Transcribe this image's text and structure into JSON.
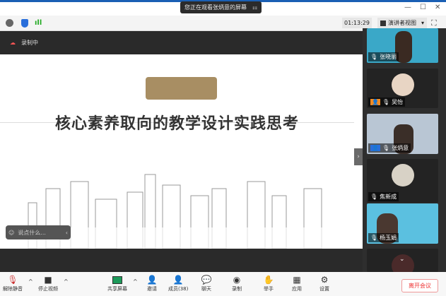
{
  "title_bar": {
    "share_banner": "您正在观看张炳意的屏幕",
    "banner_icon": "pin-icon",
    "minimize": "—",
    "maximize": "☐",
    "close": "✕"
  },
  "toolbar": {
    "timer": "01:13:29",
    "view_button": "演讲者视图",
    "icons": [
      "info-icon",
      "shield-icon",
      "signal-icon",
      "fullscreen-icon"
    ]
  },
  "recording": {
    "label": "录制中",
    "icon": "cloud-record-icon"
  },
  "slide": {
    "title": "核心素养取向的教学设计实践思考",
    "badge_color": "#a88e63"
  },
  "chat_input": {
    "placeholder": "说点什么..."
  },
  "participants": [
    {
      "name": "张晓丽",
      "type": "video"
    },
    {
      "name": "吴怡",
      "type": "avatar",
      "host": true
    },
    {
      "name": "张炳意",
      "type": "video",
      "cohost": true
    },
    {
      "name": "焦新成",
      "type": "avatar"
    },
    {
      "name": "杨玉娟",
      "type": "video"
    },
    {
      "name": "",
      "type": "avatar"
    }
  ],
  "bottom_bar": {
    "unmute": "解除静音",
    "stop_video": "停止视频",
    "share_screen": "共享屏幕",
    "invite": "邀请",
    "members": "成员(38)",
    "chat": "聊天",
    "record": "录制",
    "raise_hand": "举手",
    "apps": "应用",
    "settings": "设置",
    "leave": "离开会议"
  }
}
